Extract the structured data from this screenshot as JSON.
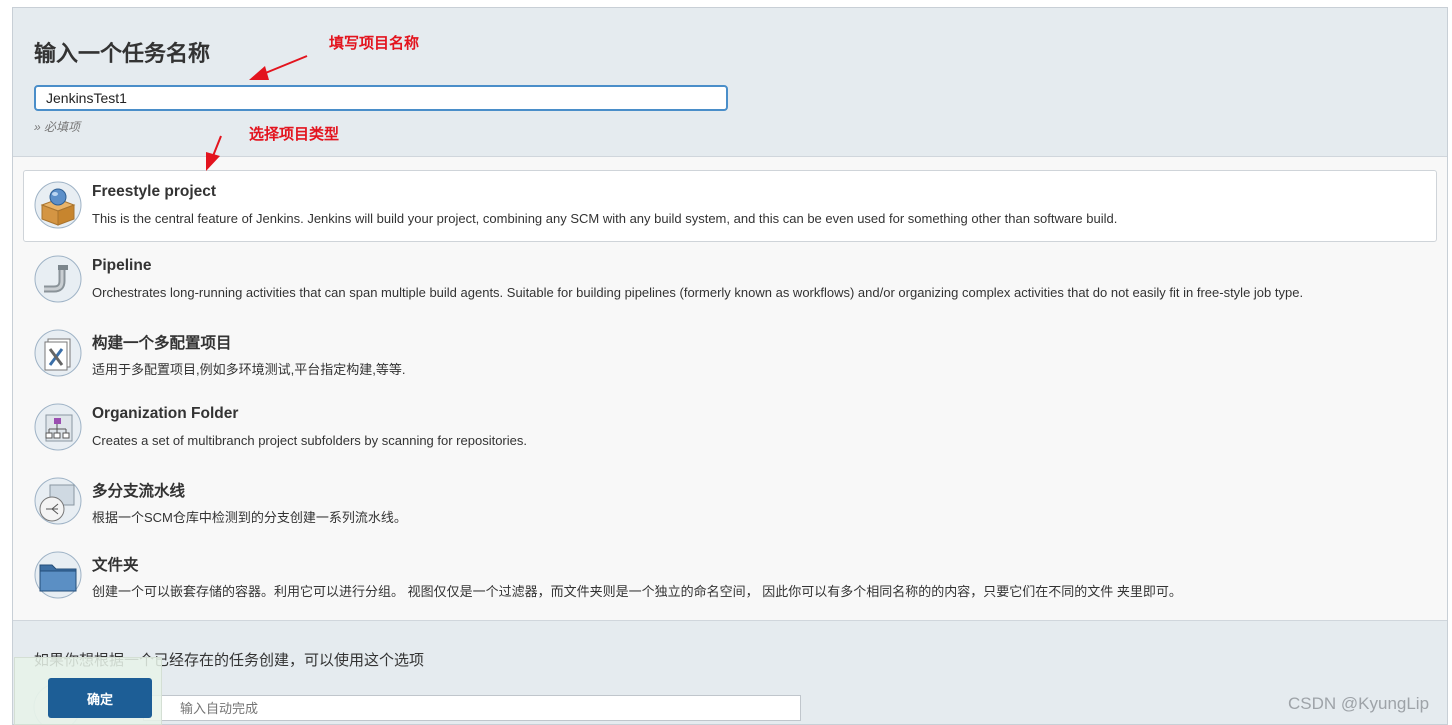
{
  "header": {
    "title": "输入一个任务名称",
    "name_value": "JenkinsTest1",
    "required_hint": "» 必填项"
  },
  "annotations": {
    "name_hint": "填写项目名称",
    "type_hint": "选择项目类型",
    "color": "#e3141e"
  },
  "items": [
    {
      "label": "Freestyle project",
      "desc": "This is the central feature of Jenkins. Jenkins will build your project, combining any SCM with any build system, and this can be even used for something other than software build.",
      "icon": "freestyle-box-icon",
      "selected": true
    },
    {
      "label": "Pipeline",
      "desc": "Orchestrates long-running activities that can span multiple build agents. Suitable for building pipelines (formerly known as workflows) and/or organizing complex activities that do not easily fit in free-style job type.",
      "icon": "pipeline-pipe-icon",
      "selected": false
    },
    {
      "label": "构建一个多配置项目",
      "desc": "适用于多配置项目,例如多环境测试,平台指定构建,等等.",
      "icon": "multi-config-icon",
      "selected": false
    },
    {
      "label": "Organization Folder",
      "desc": "Creates a set of multibranch project subfolders by scanning for repositories.",
      "icon": "organization-folder-icon",
      "selected": false
    },
    {
      "label": "多分支流水线",
      "desc": "根据一个SCM仓库中检测到的分支创建一系列流水线。",
      "icon": "multibranch-pipeline-icon",
      "selected": false
    },
    {
      "label": "文件夹",
      "desc": "创建一个可以嵌套存储的容器。利用它可以进行分组。 视图仅仅是一个过滤器，而文件夹则是一个独立的命名空间， 因此你可以有多个相同名称的的内容，只要它们在不同的文件 夹里即可。",
      "icon": "folder-icon",
      "selected": false
    }
  ],
  "copy": {
    "text": "如果你想根据一个已经存在的任务创建，可以使用这个选项",
    "placeholder": "输入自动完成"
  },
  "ok_label": "确定",
  "watermark": "CSDN @KyungLip",
  "colors": {
    "accent": "#1d5e96",
    "header_bg": "#e5ebef",
    "input_focus": "#4a8ec9"
  }
}
